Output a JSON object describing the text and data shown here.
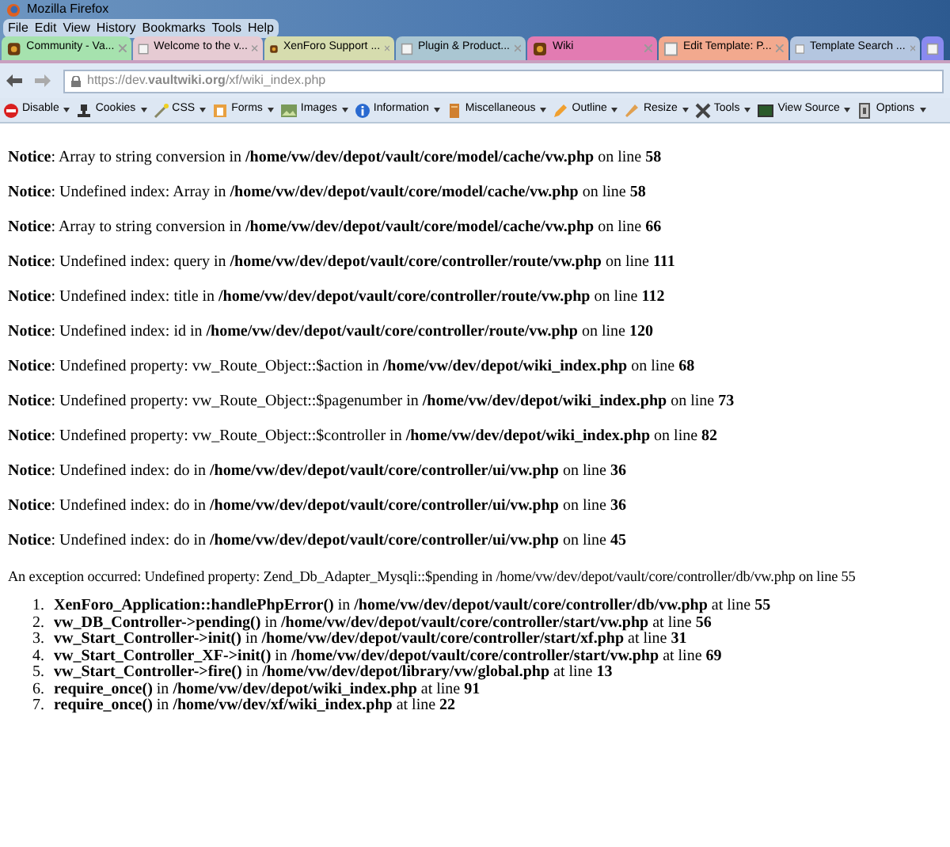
{
  "window": {
    "title": "Mozilla Firefox"
  },
  "menu": [
    "File",
    "Edit",
    "View",
    "History",
    "Bookmarks",
    "Tools",
    "Help"
  ],
  "tabs": [
    {
      "label": "Community - Va...",
      "color": "#a6e2ae",
      "kind": "favicon"
    },
    {
      "label": "Welcome to the v...",
      "color": "#e6cbd3",
      "kind": "blank"
    },
    {
      "label": "XenForo Support ...",
      "color": "#d6dcae",
      "kind": "favicon"
    },
    {
      "label": "Plugin & Product...",
      "color": "#aac6d2",
      "kind": "blank"
    },
    {
      "label": "Wiki",
      "color": "#e27bb2",
      "kind": "favicon"
    },
    {
      "label": "Edit Template: P...",
      "color": "#f2a98e",
      "kind": "blank"
    },
    {
      "label": "Template Search ...",
      "color": "#b4c6e0",
      "kind": "blank"
    },
    {
      "color": "#8a8af0",
      "kind": "blank"
    }
  ],
  "address_bar": {
    "value": "https://dev.**vaultwiki.org**/xf/wiki_index.php"
  },
  "toolbar": [
    "Disable",
    "Cookies",
    "CSS",
    "Forms",
    "Images",
    "Information",
    "Miscellaneous",
    "Outline",
    "Resize",
    "Tools",
    "View Source",
    "Options"
  ],
  "notices": [
    "**Notice**: Array to string conversion in **/home/vw/dev/depot/vault/core/model/cache/vw.php** on line **58**",
    "**Notice**: Undefined index: Array in **/home/vw/dev/depot/vault/core/model/cache/vw.php** on line **58**",
    "**Notice**: Array to string conversion in **/home/vw/dev/depot/vault/core/model/cache/vw.php** on line **66**",
    "**Notice**: Undefined index: query in **/home/vw/dev/depot/vault/core/controller/route/vw.php** on line **111**",
    "**Notice**: Undefined index: title in **/home/vw/dev/depot/vault/core/controller/route/vw.php** on line **112**",
    "**Notice**: Undefined index: id in **/home/vw/dev/depot/vault/core/controller/route/vw.php** on line **120**",
    "**Notice**: Undefined property: vw_Route_Object::$action in **/home/vw/dev/depot/wiki_index.php** on line **68**",
    "**Notice**: Undefined property: vw_Route_Object::$pagenumber in **/home/vw/dev/depot/wiki_index.php** on line **73**",
    "**Notice**: Undefined property: vw_Route_Object::$controller in **/home/vw/dev/depot/wiki_index.php** on line **82**",
    "**Notice**: Undefined index: do in **/home/vw/dev/depot/vault/core/controller/ui/vw.php** on line **36**",
    "**Notice**: Undefined index: do in **/home/vw/dev/depot/vault/core/controller/ui/vw.php** on line **36**",
    "**Notice**: Undefined index: do in **/home/vw/dev/depot/vault/core/controller/ui/vw.php** on line **45**"
  ],
  "exception": "An exception occurred: Undefined property: Zend_Db_Adapter_Mysqli::$pending in /home/vw/dev/depot/vault/core/controller/db/vw.php on line 55",
  "trace": [
    {
      "number": "1.",
      "text": "**XenForo_Application::handlePhpError()** in **/home/vw/dev/depot/vault/core/controller/db/vw.php** at line **55**"
    },
    {
      "number": "2.",
      "text": "**vw_DB_Controller->pending()** in **/home/vw/dev/depot/vault/core/controller/start/vw.php** at line **56**"
    },
    {
      "number": "3.",
      "text": "**vw_Start_Controller->init()** in **/home/vw/dev/depot/vault/core/controller/start/xf.php** at line **31**"
    },
    {
      "number": "4.",
      "text": "**vw_Start_Controller_XF->init()** in **/home/vw/dev/depot/vault/core/controller/start/vw.php** at line **69**"
    },
    {
      "number": "5.",
      "text": "**vw_Start_Controller->fire()** in **/home/vw/dev/depot/library/vw/global.php** at line **13**"
    },
    {
      "number": "6.",
      "text": "**require_once()** in **/home/vw/dev/depot/wiki_index.php** at line **91**"
    },
    {
      "number": "7.",
      "text": "**require_once()** in **/home/vw/dev/xf/wiki_index.php** at line **22**"
    }
  ]
}
